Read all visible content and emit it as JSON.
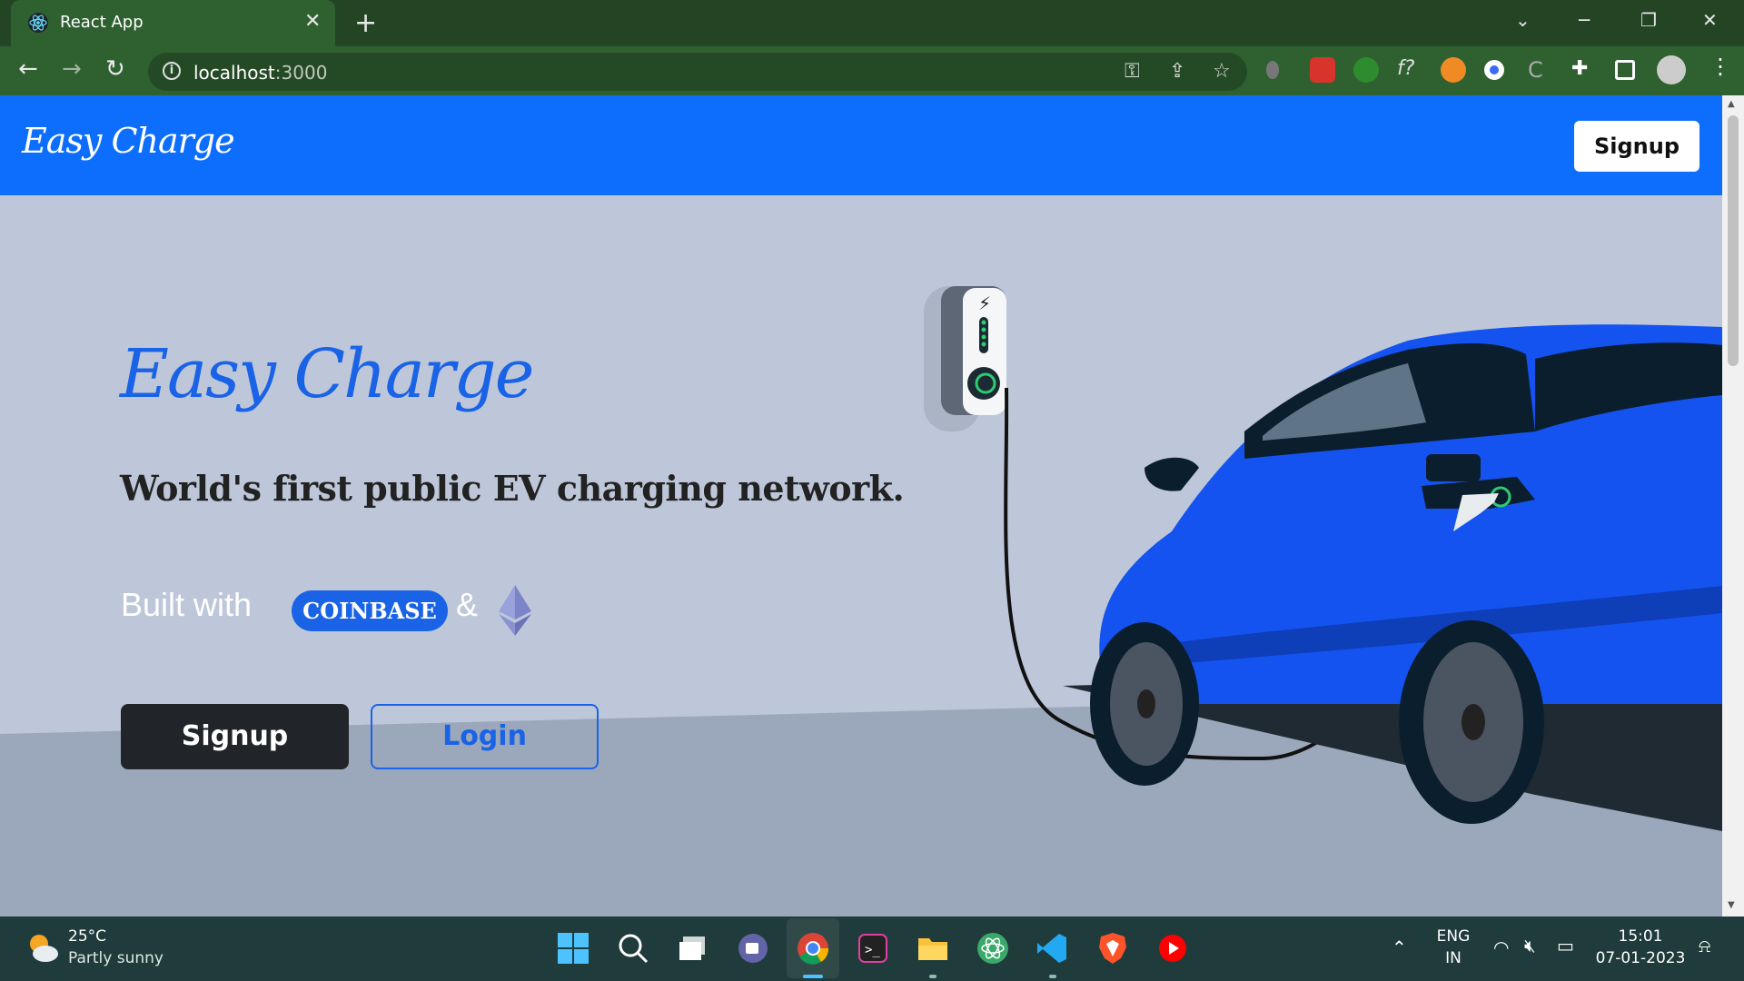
{
  "browser": {
    "tab_title": "React App",
    "tab_close": "✕",
    "new_tab": "+",
    "url_host": "localhost",
    "url_port": ":3000",
    "icons": [
      "back-icon",
      "forward-icon",
      "reload-icon",
      "key-icon",
      "share-icon",
      "star-icon",
      "extensions-icon",
      "sidepanel-icon",
      "profile-icon",
      "menu-icon"
    ]
  },
  "navbar": {
    "brand": "Easy Charge",
    "signup_label": "Signup"
  },
  "hero": {
    "title": "Easy Charge",
    "tagline": "World's first public EV charging network.",
    "built_with": "Built with",
    "coinbase": "COINBASE",
    "amp": "&",
    "signup_label": "Signup",
    "login_label": "Login"
  },
  "colors": {
    "brand_blue": "#0d6efd",
    "accent_blue": "#1a63e6",
    "page_bg": "#bec7d9",
    "chrome_green": "#2f6130"
  },
  "taskbar": {
    "temperature": "25°C",
    "condition": "Partly sunny",
    "lang_1": "ENG",
    "lang_2": "IN",
    "time": "15:01",
    "date": "07-01-2023"
  }
}
